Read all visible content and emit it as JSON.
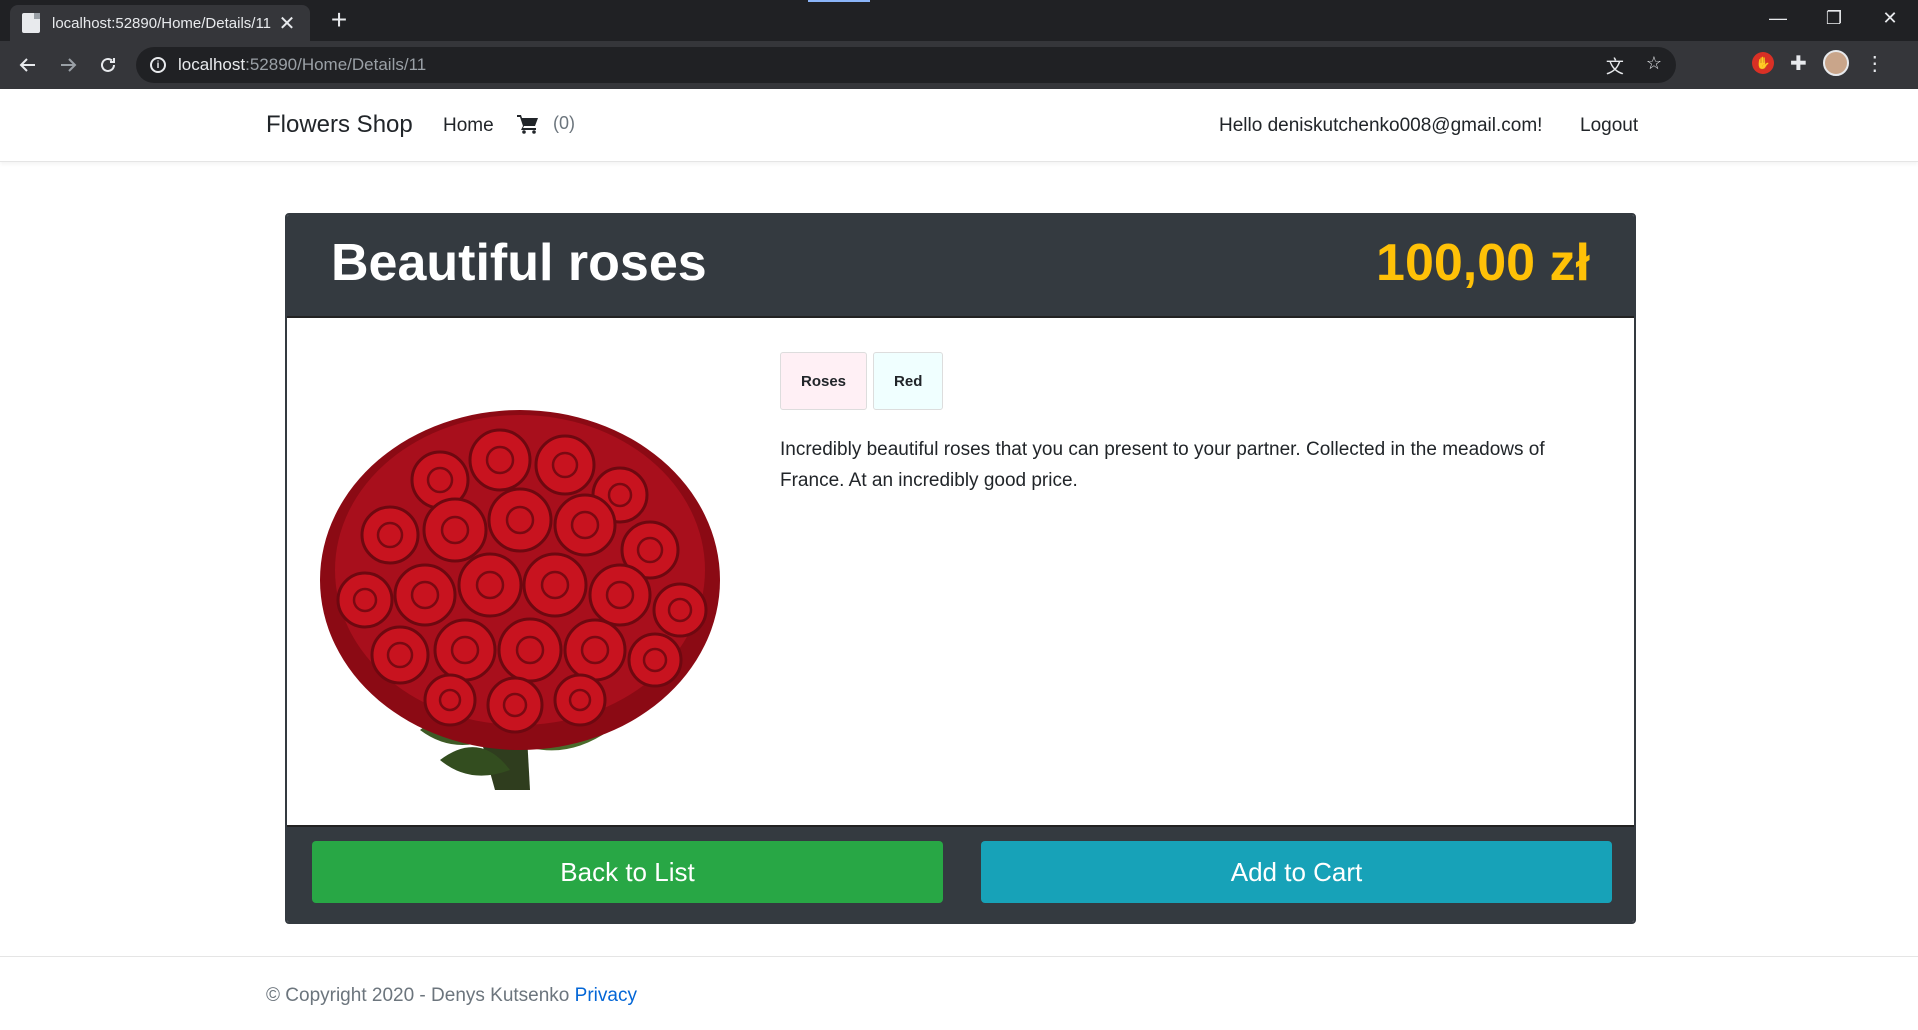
{
  "browser": {
    "tab_title": "localhost:52890/Home/Details/11",
    "tab_close": "✕",
    "new_tab": "+",
    "url_host": "localhost",
    "url_path": ":52890/Home/Details/11",
    "win_minimize": "—",
    "win_restore": "❐",
    "win_close": "✕"
  },
  "navbar": {
    "brand": "Flowers Shop",
    "home": "Home",
    "cart_count": "(0)",
    "greeting": "Hello deniskutchenko008@gmail.com!",
    "logout": "Logout"
  },
  "product": {
    "title": "Beautiful roses",
    "price": "100,00 zł",
    "badges": [
      "Roses",
      "Red"
    ],
    "description": "Incredibly beautiful roses that you can present to your partner. Collected in the meadows of France. At an incredibly good price."
  },
  "actions": {
    "back": "Back to List",
    "add_to_cart": "Add to Cart"
  },
  "footer": {
    "copyright": "© Copyright 2020 - Denys Kutsenko",
    "privacy": "Privacy"
  },
  "colors": {
    "header_bg": "#343a40",
    "price": "#ffc107",
    "back_button": "#28a745",
    "cart_button": "#17a2b8",
    "link": "#0366d6"
  },
  "icons": [
    "page-favicon-icon",
    "close-icon",
    "plus-icon",
    "back-arrow-icon",
    "forward-arrow-icon",
    "reload-icon",
    "info-icon",
    "translate-icon",
    "star-icon",
    "stop-extension-icon",
    "puzzle-icon",
    "profile-avatar-icon",
    "kebab-menu-icon",
    "cart-icon"
  ]
}
